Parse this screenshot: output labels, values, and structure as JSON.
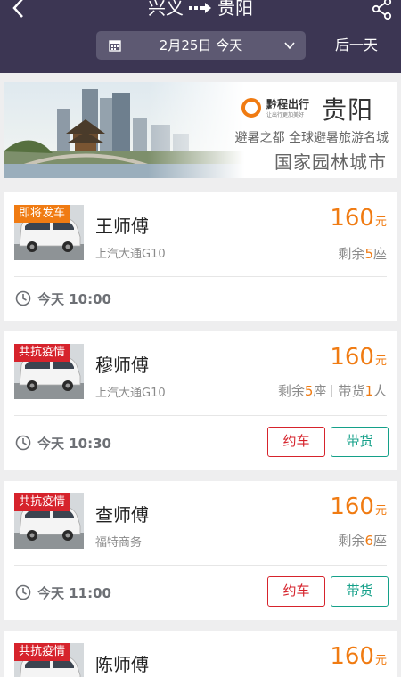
{
  "header": {
    "origin": "兴义",
    "destination": "贵阳",
    "date": "2月25日 今天",
    "next_day": "后一天",
    "icons": [
      "back-icon",
      "route-arrow-icon",
      "share-icon",
      "calendar-icon",
      "chevron-down-icon"
    ]
  },
  "banner": {
    "logo_name": "黔程出行",
    "logo_sub": "让出行更加美好",
    "city": "贵阳",
    "tagline1": "避暑之都 全球避暑旅游名城",
    "tagline2": "国家园林城市"
  },
  "trips": [
    {
      "badge": "即将发车",
      "driver": "王师傅",
      "model": "上汽大通G10",
      "price": "160",
      "unit": "元",
      "seats_prefix": "剩余",
      "seats": "5",
      "seats_suffix": "座",
      "time": "今天 10:00"
    },
    {
      "badge": "共抗疫情",
      "driver": "穆师傅",
      "model": "上汽大通G10",
      "price": "160",
      "unit": "元",
      "seats_prefix": "剩余",
      "seats": "5",
      "seats_suffix": "座",
      "cargo_prefix": "带货",
      "cargo": "1",
      "cargo_suffix": "人",
      "time": "今天 10:30",
      "book_label": "约车",
      "cargo_label": "带货"
    },
    {
      "badge": "共抗疫情",
      "driver": "查师傅",
      "model": "福特商务",
      "price": "160",
      "unit": "元",
      "seats_prefix": "剩余",
      "seats": "6",
      "seats_suffix": "座",
      "time": "今天 11:00",
      "book_label": "约车",
      "cargo_label": "带货"
    },
    {
      "badge": "共抗疫情",
      "driver": "陈师傅",
      "price": "160",
      "unit": "元"
    }
  ],
  "colors": {
    "header_bg": "#3c3653",
    "accent_orange": "#f07b12",
    "accent_red": "#d6232c",
    "accent_green": "#14a089"
  }
}
